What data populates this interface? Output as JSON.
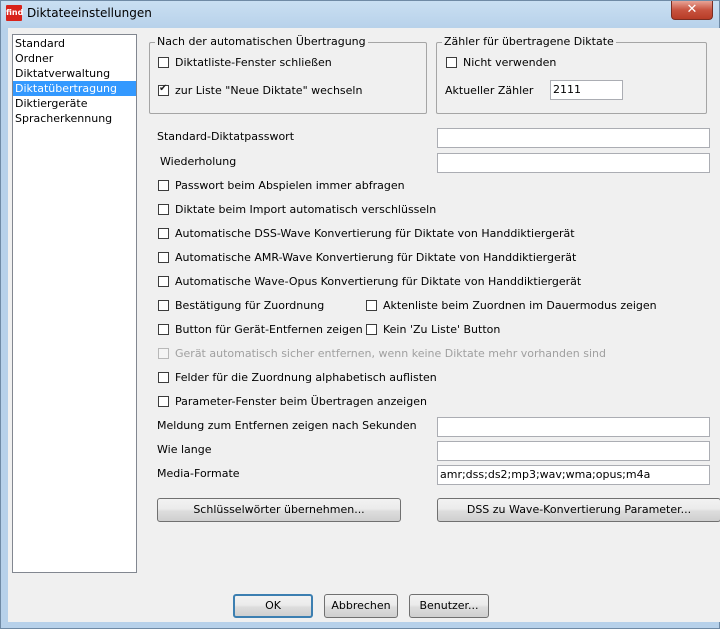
{
  "window": {
    "title": "Diktateeinstellungen",
    "app_icon_text": "find",
    "close_glyph": "✕"
  },
  "nav": {
    "items": [
      {
        "label": "Standard",
        "selected": false
      },
      {
        "label": "Ordner",
        "selected": false
      },
      {
        "label": "Diktatverwaltung",
        "selected": false
      },
      {
        "label": "Diktatübertragung",
        "selected": true
      },
      {
        "label": "Diktiergeräte",
        "selected": false
      },
      {
        "label": "Spracherkennung",
        "selected": false
      }
    ]
  },
  "after_transfer": {
    "legend": "Nach der automatischen Übertragung",
    "close_window": {
      "label": "Diktatliste-Fenster schließen",
      "checked": false
    },
    "switch_list": {
      "label": "zur Liste \"Neue Diktate\"  wechseln",
      "checked": true
    }
  },
  "counter": {
    "legend": "Zähler für übertragene Diktate",
    "not_use": {
      "label": "Nicht verwenden",
      "checked": false
    },
    "current_label": "Aktueller Zähler",
    "current_value": "2111"
  },
  "password": {
    "label": "Standard-Diktatpasswort",
    "value": "",
    "repeat_label": "Wiederholung",
    "repeat_value": ""
  },
  "options": {
    "ask_password": {
      "label": "Passwort beim Abspielen immer abfragen",
      "checked": false
    },
    "encrypt_import": {
      "label": "Diktate beim Import automatisch verschlüsseln",
      "checked": false
    },
    "dss_wave": {
      "label": "Automatische DSS-Wave Konvertierung für Diktate von Handdiktiergerät",
      "checked": false
    },
    "amr_wave": {
      "label": "Automatische AMR-Wave Konvertierung für Diktate von Handdiktiergerät",
      "checked": false
    },
    "wave_opus": {
      "label": "Automatische Wave-Opus Konvertierung für Diktate von Handdiktiergerät",
      "checked": false
    },
    "confirm_assign": {
      "label": "Bestätigung für Zuordnung",
      "checked": false
    },
    "file_list": {
      "label": "Aktenliste beim Zuordnen im Dauermodus zeigen",
      "checked": false
    },
    "remove_device_btn": {
      "label": "Button für Gerät-Entfernen zeigen",
      "checked": false
    },
    "no_list_btn": {
      "label": "Kein 'Zu Liste' Button",
      "checked": false
    },
    "auto_remove": {
      "label": "Gerät automatisch sicher entfernen, wenn keine Diktate mehr vorhanden sind",
      "checked": false,
      "disabled": true
    },
    "alpha_fields": {
      "label": "Felder für die Zuordnung alphabetisch auflisten",
      "checked": false
    },
    "param_window": {
      "label": "Parameter-Fenster beim Übertragen anzeigen",
      "checked": false
    }
  },
  "fields": {
    "remove_msg_label": "Meldung zum Entfernen zeigen nach Sekunden",
    "remove_msg_value": "",
    "duration_label": "Wie lange",
    "duration_value": "",
    "media_label": "Media-Formate",
    "media_value": "amr;dss;ds2;mp3;wav;wma;opus;m4a"
  },
  "buttons": {
    "keywords": "Schlüsselwörter übernehmen...",
    "dss_params": "DSS zu Wave-Konvertierung Parameter...",
    "ok": "OK",
    "cancel": "Abbrechen",
    "user": "Benutzer..."
  }
}
